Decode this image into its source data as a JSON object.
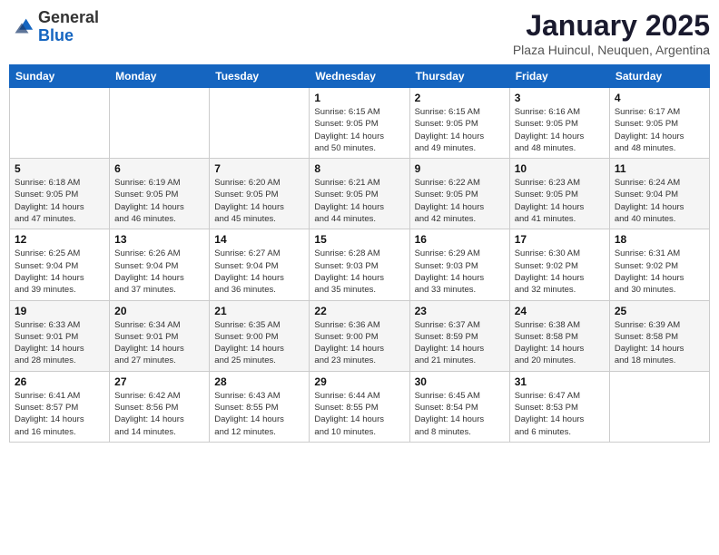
{
  "header": {
    "logo_general": "General",
    "logo_blue": "Blue",
    "month_title": "January 2025",
    "subtitle": "Plaza Huincul, Neuquen, Argentina"
  },
  "weekdays": [
    "Sunday",
    "Monday",
    "Tuesday",
    "Wednesday",
    "Thursday",
    "Friday",
    "Saturday"
  ],
  "weeks": [
    [
      {
        "day": "",
        "info": ""
      },
      {
        "day": "",
        "info": ""
      },
      {
        "day": "",
        "info": ""
      },
      {
        "day": "1",
        "info": "Sunrise: 6:15 AM\nSunset: 9:05 PM\nDaylight: 14 hours\nand 50 minutes."
      },
      {
        "day": "2",
        "info": "Sunrise: 6:15 AM\nSunset: 9:05 PM\nDaylight: 14 hours\nand 49 minutes."
      },
      {
        "day": "3",
        "info": "Sunrise: 6:16 AM\nSunset: 9:05 PM\nDaylight: 14 hours\nand 48 minutes."
      },
      {
        "day": "4",
        "info": "Sunrise: 6:17 AM\nSunset: 9:05 PM\nDaylight: 14 hours\nand 48 minutes."
      }
    ],
    [
      {
        "day": "5",
        "info": "Sunrise: 6:18 AM\nSunset: 9:05 PM\nDaylight: 14 hours\nand 47 minutes."
      },
      {
        "day": "6",
        "info": "Sunrise: 6:19 AM\nSunset: 9:05 PM\nDaylight: 14 hours\nand 46 minutes."
      },
      {
        "day": "7",
        "info": "Sunrise: 6:20 AM\nSunset: 9:05 PM\nDaylight: 14 hours\nand 45 minutes."
      },
      {
        "day": "8",
        "info": "Sunrise: 6:21 AM\nSunset: 9:05 PM\nDaylight: 14 hours\nand 44 minutes."
      },
      {
        "day": "9",
        "info": "Sunrise: 6:22 AM\nSunset: 9:05 PM\nDaylight: 14 hours\nand 42 minutes."
      },
      {
        "day": "10",
        "info": "Sunrise: 6:23 AM\nSunset: 9:05 PM\nDaylight: 14 hours\nand 41 minutes."
      },
      {
        "day": "11",
        "info": "Sunrise: 6:24 AM\nSunset: 9:04 PM\nDaylight: 14 hours\nand 40 minutes."
      }
    ],
    [
      {
        "day": "12",
        "info": "Sunrise: 6:25 AM\nSunset: 9:04 PM\nDaylight: 14 hours\nand 39 minutes."
      },
      {
        "day": "13",
        "info": "Sunrise: 6:26 AM\nSunset: 9:04 PM\nDaylight: 14 hours\nand 37 minutes."
      },
      {
        "day": "14",
        "info": "Sunrise: 6:27 AM\nSunset: 9:04 PM\nDaylight: 14 hours\nand 36 minutes."
      },
      {
        "day": "15",
        "info": "Sunrise: 6:28 AM\nSunset: 9:03 PM\nDaylight: 14 hours\nand 35 minutes."
      },
      {
        "day": "16",
        "info": "Sunrise: 6:29 AM\nSunset: 9:03 PM\nDaylight: 14 hours\nand 33 minutes."
      },
      {
        "day": "17",
        "info": "Sunrise: 6:30 AM\nSunset: 9:02 PM\nDaylight: 14 hours\nand 32 minutes."
      },
      {
        "day": "18",
        "info": "Sunrise: 6:31 AM\nSunset: 9:02 PM\nDaylight: 14 hours\nand 30 minutes."
      }
    ],
    [
      {
        "day": "19",
        "info": "Sunrise: 6:33 AM\nSunset: 9:01 PM\nDaylight: 14 hours\nand 28 minutes."
      },
      {
        "day": "20",
        "info": "Sunrise: 6:34 AM\nSunset: 9:01 PM\nDaylight: 14 hours\nand 27 minutes."
      },
      {
        "day": "21",
        "info": "Sunrise: 6:35 AM\nSunset: 9:00 PM\nDaylight: 14 hours\nand 25 minutes."
      },
      {
        "day": "22",
        "info": "Sunrise: 6:36 AM\nSunset: 9:00 PM\nDaylight: 14 hours\nand 23 minutes."
      },
      {
        "day": "23",
        "info": "Sunrise: 6:37 AM\nSunset: 8:59 PM\nDaylight: 14 hours\nand 21 minutes."
      },
      {
        "day": "24",
        "info": "Sunrise: 6:38 AM\nSunset: 8:58 PM\nDaylight: 14 hours\nand 20 minutes."
      },
      {
        "day": "25",
        "info": "Sunrise: 6:39 AM\nSunset: 8:58 PM\nDaylight: 14 hours\nand 18 minutes."
      }
    ],
    [
      {
        "day": "26",
        "info": "Sunrise: 6:41 AM\nSunset: 8:57 PM\nDaylight: 14 hours\nand 16 minutes."
      },
      {
        "day": "27",
        "info": "Sunrise: 6:42 AM\nSunset: 8:56 PM\nDaylight: 14 hours\nand 14 minutes."
      },
      {
        "day": "28",
        "info": "Sunrise: 6:43 AM\nSunset: 8:55 PM\nDaylight: 14 hours\nand 12 minutes."
      },
      {
        "day": "29",
        "info": "Sunrise: 6:44 AM\nSunset: 8:55 PM\nDaylight: 14 hours\nand 10 minutes."
      },
      {
        "day": "30",
        "info": "Sunrise: 6:45 AM\nSunset: 8:54 PM\nDaylight: 14 hours\nand 8 minutes."
      },
      {
        "day": "31",
        "info": "Sunrise: 6:47 AM\nSunset: 8:53 PM\nDaylight: 14 hours\nand 6 minutes."
      },
      {
        "day": "",
        "info": ""
      }
    ]
  ]
}
